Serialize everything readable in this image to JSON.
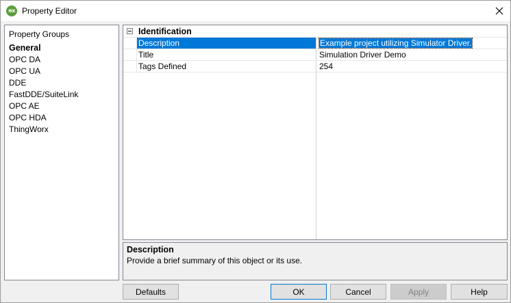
{
  "window": {
    "title": "Property Editor",
    "app_icon_text": "ex",
    "app_icon_color": "#5c9e3c"
  },
  "left_panel": {
    "header": "Property Groups",
    "groups": [
      "General",
      "OPC DA",
      "OPC UA",
      "DDE",
      "FastDDE/SuiteLink",
      "OPC AE",
      "OPC HDA",
      "ThingWorx"
    ],
    "active_group": "General"
  },
  "grid": {
    "category": "Identification",
    "rows": [
      {
        "name": "Description",
        "value": "Example project utilizing Simulator Driver."
      },
      {
        "name": "Title",
        "value": "Simulation Driver Demo"
      },
      {
        "name": "Tags Defined",
        "value": "254"
      }
    ],
    "selected_row": "Description",
    "selection_color": "#0078d7"
  },
  "help": {
    "title": "Description",
    "text": "Provide a brief summary of this object or its use."
  },
  "buttons": {
    "defaults": "Defaults",
    "ok": "OK",
    "cancel": "Cancel",
    "apply": "Apply",
    "help": "Help"
  }
}
